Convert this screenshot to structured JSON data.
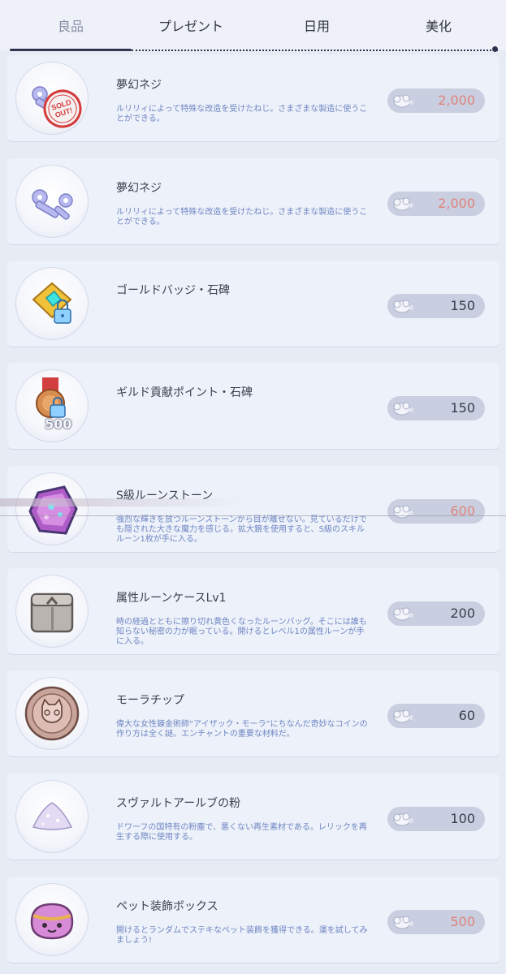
{
  "tabs": [
    {
      "label": "良品",
      "active": true
    },
    {
      "label": "プレゼント",
      "active": false
    },
    {
      "label": "日用",
      "active": false
    },
    {
      "label": "美化",
      "active": false
    }
  ],
  "items": [
    {
      "name": "夢幻ネジ",
      "desc": "ルリリィによって特殊な改造を受けたねじ。さまざまな製造に使うことができる。",
      "price": "2,000",
      "price_color": "red",
      "icon": "screw-icon",
      "sold_out": true,
      "sold_out_label": "SOLD OUT!"
    },
    {
      "name": "夢幻ネジ",
      "desc": "ルリリィによって特殊な改造を受けたねじ。さまざまな製造に使うことができる。",
      "price": "2,000",
      "price_color": "red",
      "icon": "screw-icon",
      "sold_out": false
    },
    {
      "name": "ゴールドバッジ・石碑",
      "desc": "",
      "price": "150",
      "price_color": "normal",
      "icon": "gold-badge-lock-icon",
      "sold_out": false
    },
    {
      "name": "ギルド貢献ポイント・石碑",
      "desc": "",
      "price": "150",
      "price_color": "normal",
      "icon": "guild-medal-lock-icon",
      "icon_count": "500",
      "sold_out": false
    },
    {
      "name": "S級ルーンストーン",
      "desc": "強烈な輝きを放つルーンストーンから目が離せない。見ているだけでも隠された大きな魔力を感じる。拡大鏡を使用すると、S級のスキルルーン1枚が手に入る。",
      "price": "600",
      "price_color": "red",
      "icon": "rune-stone-icon",
      "sold_out": false
    },
    {
      "name": "属性ルーンケースLv1",
      "desc": "時の経過とともに擦り切れ黄色くなったルーンバッグ。そこには誰も知らない秘密の力が眠っている。開けるとレベル1の属性ルーンが手に入る。",
      "price": "200",
      "price_color": "normal",
      "icon": "rune-case-icon",
      "sold_out": false
    },
    {
      "name": "モーラチップ",
      "desc": "偉大な女性錬金術師“アイザック・モーラ”にちなんだ奇妙なコインの作り方は全く謎。エンチャントの重要な材料だ。",
      "price": "60",
      "price_color": "normal",
      "icon": "mora-chip-icon",
      "sold_out": false
    },
    {
      "name": "スヴァルトアールブの粉",
      "desc": "ドワーフの国特有の粉塵で、悪くない再生素材である。レリックを再生する際に使用する。",
      "price": "100",
      "price_color": "normal",
      "icon": "powder-icon",
      "sold_out": false
    },
    {
      "name": "ペット装飾ボックス",
      "desc": "開けるとランダムでステキなペット装飾を獲得できる。運を試してみましょう!",
      "price": "500",
      "price_color": "red",
      "icon": "pet-box-icon",
      "sold_out": false
    }
  ],
  "colors": {
    "price_red": "#e0827a",
    "price_normal": "#3a3f4e",
    "desc": "#6f86c4",
    "accent": "#2e3350"
  }
}
